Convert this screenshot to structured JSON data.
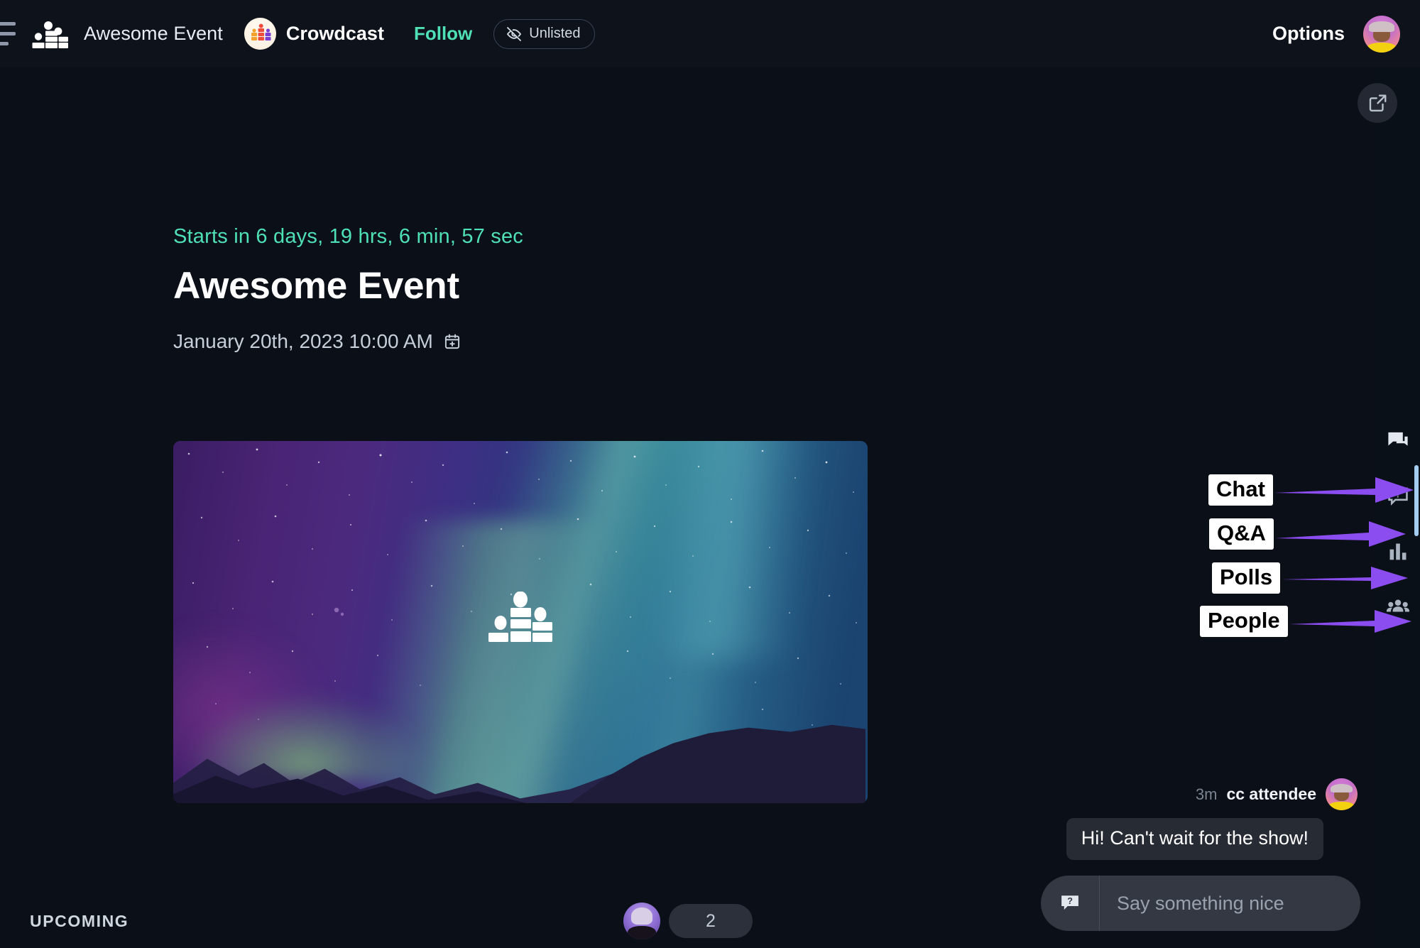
{
  "topbar": {
    "menu_icon": "hamburger-menu-icon",
    "logo_icon": "crowdcast-podium-logo-icon",
    "event_name": "Awesome Event",
    "brand": {
      "name": "Crowdcast",
      "avatar_icon": "crowdcast-brand-avatar"
    },
    "follow_label": "Follow",
    "visibility_badge": {
      "label": "Unlisted",
      "icon": "eye-off-icon"
    },
    "options_label": "Options",
    "user_avatar_icon": "user-profile-avatar"
  },
  "main": {
    "popout_icon": "external-link-icon",
    "countdown": "Starts in 6 days, 19 hrs, 6 min, 57 sec",
    "title": "Awesome Event",
    "date": "January 20th, 2023 10:00 AM",
    "calendar_icon": "add-to-calendar-icon",
    "hero": {
      "alt": "aurora-borealis-event-cover",
      "center_logo_icon": "crowdcast-podium-logo-icon"
    }
  },
  "sidebar": {
    "items": [
      {
        "label": "Chat",
        "icon": "chat-bubbles-icon"
      },
      {
        "label": "Q&A",
        "icon": "question-bubble-icon"
      },
      {
        "label": "Polls",
        "icon": "bar-chart-icon"
      },
      {
        "label": "People",
        "icon": "people-group-icon"
      }
    ]
  },
  "annotations": [
    {
      "label": "Chat",
      "arrow": "right-arrow"
    },
    {
      "label": "Q&A",
      "arrow": "right-arrow"
    },
    {
      "label": "Polls",
      "arrow": "right-arrow"
    },
    {
      "label": "People",
      "arrow": "right-arrow"
    }
  ],
  "chat": {
    "message": {
      "time": "3m",
      "author": "cc attendee",
      "text": "Hi! Can't wait for the show!",
      "avatar_icon": "cc-attendee-avatar"
    },
    "composer": {
      "qa_toggle_icon": "question-bubble-icon",
      "placeholder": "Say something nice",
      "value": "",
      "emoji_icon": "smiley-face-icon"
    }
  },
  "bottombar": {
    "status_label": "UPCOMING",
    "attendee_avatar_icon": "attendee-avatar",
    "attendee_count": "2"
  },
  "colors": {
    "app_background": "#0b0f17",
    "topbar_background": "#0d121b",
    "sidebar_background": "#0a1018",
    "accent_teal": "#4fe0b5",
    "annotation_purple": "#8b4df0",
    "annotation_label_bg": "#ffffff",
    "scroll_indicator": "#a4cdf2",
    "composer_background": "#333842",
    "bubble_background": "#272b33"
  }
}
